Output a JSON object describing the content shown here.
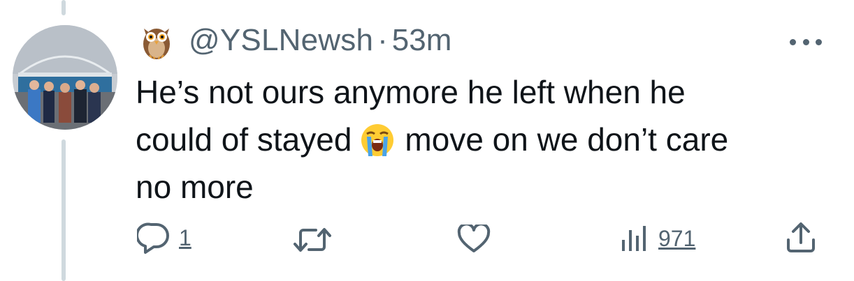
{
  "tweet": {
    "handle": "@YSLNewsh",
    "separator": "·",
    "time": "53m",
    "text_lines": [
      "He’s not ours anymore he left when he",
      "move on we don’t care",
      "no more"
    ],
    "text_line2_prefix": "could of stayed",
    "author_emoji": "owl-emoji",
    "inline_emoji": "loudly-crying-face-emoji"
  },
  "actions": {
    "reply_count": "1",
    "views_count": "971"
  },
  "icons": [
    "reply-icon",
    "retweet-icon",
    "like-icon",
    "views-icon",
    "share-icon",
    "more-icon"
  ],
  "colors": {
    "text": "#0f1419",
    "secondary": "#536471",
    "thread_line": "#cfd9de"
  }
}
